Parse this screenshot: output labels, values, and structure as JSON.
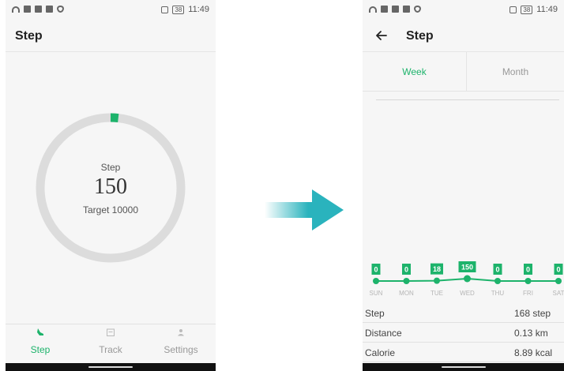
{
  "left_screen": {
    "status": {
      "time": "11:49",
      "battery": "38"
    },
    "appbar": {
      "title": "Step"
    },
    "ring": {
      "caption": "Step",
      "value": "150",
      "target": "Target 10000",
      "progress": 0.015
    },
    "nav": [
      {
        "label": "Step",
        "icon": "shoe-icon",
        "active": true
      },
      {
        "label": "Track",
        "icon": "calendar-icon",
        "active": false
      },
      {
        "label": "Settings",
        "icon": "person-icon",
        "active": false
      }
    ]
  },
  "right_screen": {
    "status": {
      "time": "11:49",
      "battery": "38"
    },
    "appbar": {
      "title": "Step"
    },
    "tabs": {
      "week": "Week",
      "month": "Month"
    },
    "chart_data": {
      "type": "line",
      "categories": [
        "SUN",
        "MON",
        "TUE",
        "WED",
        "THU",
        "FRI",
        "SAT"
      ],
      "values": [
        0,
        0,
        18,
        150,
        0,
        0,
        0
      ],
      "value_labels": [
        "0",
        "0",
        "18",
        "150",
        "0",
        "0",
        "0"
      ]
    },
    "stats": [
      {
        "label": "Step",
        "value": "168 step"
      },
      {
        "label": "Distance",
        "value": "0.13 km"
      },
      {
        "label": "Calorie",
        "value": "8.89 kcal"
      }
    ]
  },
  "colors": {
    "accent": "#1db36b",
    "ring_track": "#dcdcdc",
    "arrow": "#2ab3bd"
  }
}
